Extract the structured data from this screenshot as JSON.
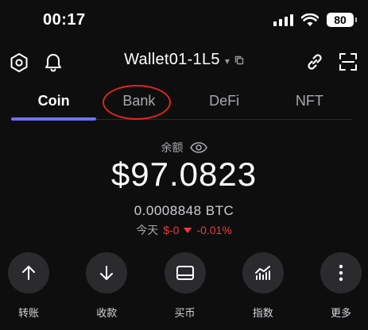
{
  "status_bar": {
    "time": "00:17",
    "battery": "80"
  },
  "header": {
    "wallet_name": "Wallet01-1L5"
  },
  "tabs": [
    {
      "label": "Coin",
      "active": true
    },
    {
      "label": "Bank",
      "active": false
    },
    {
      "label": "DeFi",
      "active": false
    },
    {
      "label": "NFT",
      "active": false
    }
  ],
  "balance": {
    "label": "余额",
    "value": "$97.0823",
    "btc": "0.0008848 BTC",
    "change_label": "今天",
    "change_amount": "$-0",
    "change_percent": "-0.01%"
  },
  "actions": [
    {
      "label": "转账",
      "icon": "arrow-up-icon"
    },
    {
      "label": "收款",
      "icon": "arrow-down-icon"
    },
    {
      "label": "买币",
      "icon": "card-icon"
    },
    {
      "label": "指数",
      "icon": "chart-icon"
    },
    {
      "label": "更多",
      "icon": "more-icon"
    }
  ],
  "colors": {
    "background": "#0e0e0f",
    "tab_indicator": "#6f72f5",
    "negative": "#f0393a",
    "annotation_circle": "#e0251b",
    "action_bg": "#2b2b2e"
  }
}
